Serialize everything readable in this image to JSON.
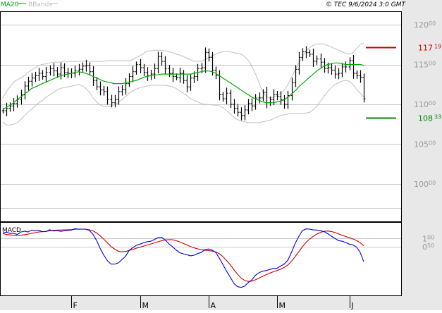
{
  "header": {
    "indicator_ma": "MA20",
    "indicator_bb": "BBands",
    "copyright": "© TEC 9/6/2024 3:0 GMT"
  },
  "colors": {
    "background": "#ffffff",
    "panel_shade": "#e8e8e8",
    "grid": "#c8c8c8",
    "border": "#000000",
    "bars": "#000000",
    "ma": "#00aa00",
    "bands": "#c0c0c0",
    "resistance": "#cc0000",
    "support": "#008800",
    "macd": "#0000dd",
    "signal": "#cc0000",
    "label_text": "#999999",
    "header_text": "#000000"
  },
  "levels": {
    "resistance": {
      "value": 117.19,
      "main": "117",
      "dec": "19"
    },
    "support": {
      "value": 108.33,
      "main": "108",
      "dec": "33"
    }
  },
  "chart_data": [
    {
      "type": "ohlc",
      "panel": "price",
      "xlabel": "",
      "ylabel": "",
      "x_tick_labels": [
        "F",
        "M",
        "A",
        "M",
        "J"
      ],
      "x_tick_positions": [
        19,
        38,
        57,
        76,
        96
      ],
      "y_ticks": [
        {
          "value": 120,
          "main": "120",
          "dec": "00"
        },
        {
          "value": 115,
          "main": "115",
          "dec": "00"
        },
        {
          "value": 110,
          "main": "110",
          "dec": "00"
        },
        {
          "value": 105,
          "main": "105",
          "dec": "00"
        },
        {
          "value": 100,
          "main": "100",
          "dec": "00"
        }
      ],
      "ylim": [
        95.3,
        121.6
      ],
      "grid": true,
      "closes": [
        109.2,
        109.5,
        109.8,
        110.1,
        110.6,
        111.2,
        112.3,
        112.9,
        113.3,
        113.6,
        113.9,
        113.5,
        114.0,
        114.5,
        114.2,
        113.8,
        114.6,
        114.0,
        113.9,
        113.9,
        114.3,
        114.4,
        114.8,
        114.9,
        114.1,
        113.0,
        112.2,
        111.8,
        111.6,
        110.6,
        110.2,
        110.6,
        111.6,
        111.9,
        112.6,
        113.5,
        114.1,
        115.0,
        114.6,
        114.0,
        113.6,
        113.8,
        114.5,
        116.0,
        115.4,
        114.5,
        113.9,
        113.5,
        113.4,
        113.9,
        113.0,
        112.2,
        113.3,
        113.5,
        114.5,
        114.6,
        116.5,
        115.9,
        114.3,
        113.6,
        111.2,
        110.7,
        111.4,
        110.0,
        109.5,
        109.0,
        108.6,
        109.3,
        110.1,
        109.8,
        110.8,
        110.8,
        111.5,
        110.2,
        110.6,
        111.2,
        111.0,
        110.6,
        110.0,
        111.1,
        112.7,
        114.4,
        115.9,
        116.6,
        116.5,
        116.3,
        115.4,
        115.7,
        115.3,
        114.5,
        114.6,
        114.3,
        113.8,
        113.9,
        114.7,
        114.7,
        115.5,
        113.9,
        113.6,
        113.4,
        110.7
      ],
      "ma20": [
        109.4,
        109.6,
        109.9,
        110.2,
        110.6,
        110.9,
        111.3,
        111.6,
        112.0,
        112.2,
        112.4,
        112.6,
        112.8,
        113.0,
        113.2,
        113.4,
        113.6,
        113.7,
        113.8,
        113.9,
        114.0,
        114.1,
        114.0,
        113.9,
        113.7,
        113.5,
        113.3,
        113.1,
        112.9,
        112.8,
        112.7,
        112.6,
        112.6,
        112.6,
        112.7,
        112.8,
        112.9,
        113.0,
        113.2,
        113.4,
        113.5,
        113.6,
        113.7,
        113.7,
        113.8,
        113.8,
        113.8,
        113.8,
        113.8,
        113.8,
        113.8,
        113.8,
        113.8,
        113.9,
        114.0,
        114.1,
        114.2,
        114.2,
        114.1,
        113.9,
        113.6,
        113.3,
        113.0,
        112.7,
        112.4,
        112.1,
        111.8,
        111.5,
        111.2,
        110.9,
        110.7,
        110.5,
        110.3,
        110.2,
        110.2,
        110.2,
        110.3,
        110.4,
        110.6,
        110.9,
        111.3,
        111.7,
        112.2,
        112.6,
        113.0,
        113.4,
        113.8,
        114.2,
        114.5,
        114.8,
        115.0,
        115.1,
        115.2,
        115.2,
        115.1,
        115.0,
        115.0,
        115.0,
        115.0,
        115.0,
        114.9
      ],
      "bb_upper": [
        110.8,
        111.6,
        112.2,
        112.8,
        113.1,
        113.3,
        113.6,
        114.0,
        114.3,
        114.6,
        114.9,
        115.0,
        115.1,
        115.2,
        115.3,
        115.3,
        115.3,
        115.4,
        115.4,
        115.4,
        115.4,
        115.4,
        115.4,
        115.4,
        115.4,
        115.4,
        115.4,
        115.4,
        115.4,
        115.5,
        115.5,
        115.5,
        115.5,
        115.5,
        115.5,
        115.5,
        115.6,
        115.9,
        116.1,
        116.4,
        116.7,
        116.7,
        116.8,
        116.8,
        116.8,
        116.7,
        116.6,
        116.5,
        116.3,
        116.2,
        116.0,
        115.8,
        115.6,
        115.4,
        115.4,
        115.4,
        115.6,
        115.9,
        116.1,
        116.3,
        116.5,
        116.6,
        116.6,
        116.6,
        116.5,
        116.4,
        116.3,
        116.0,
        115.5,
        114.8,
        113.8,
        112.7,
        111.6,
        111.0,
        110.8,
        110.9,
        111.1,
        111.4,
        111.8,
        112.5,
        113.4,
        114.3,
        115.2,
        116.0,
        116.7,
        117.1,
        117.4,
        117.6,
        117.6,
        117.6,
        117.4,
        117.2,
        117.0,
        116.8,
        116.6,
        116.4,
        116.3,
        116.5,
        117.0,
        117.5,
        117.7
      ],
      "bb_lower": [
        107.8,
        107.4,
        107.4,
        107.5,
        107.7,
        108.1,
        108.6,
        109.0,
        109.4,
        109.8,
        110.2,
        110.5,
        110.9,
        111.2,
        111.5,
        111.8,
        112.0,
        112.1,
        112.2,
        112.3,
        112.4,
        112.5,
        112.3,
        112.0,
        111.5,
        110.8,
        110.3,
        109.9,
        109.7,
        109.7,
        109.8,
        110.0,
        110.2,
        110.6,
        111.0,
        111.4,
        111.7,
        111.9,
        112.1,
        112.2,
        112.3,
        112.4,
        112.4,
        112.4,
        112.4,
        112.4,
        112.3,
        112.2,
        112.0,
        111.7,
        111.4,
        111.1,
        110.7,
        110.5,
        110.3,
        110.1,
        110.0,
        110.0,
        109.9,
        109.9,
        109.8,
        109.6,
        109.2,
        108.8,
        108.4,
        108.1,
        107.9,
        107.8,
        107.7,
        107.7,
        107.7,
        107.7,
        107.8,
        107.9,
        108.0,
        108.2,
        108.4,
        108.6,
        108.7,
        108.8,
        108.8,
        108.8,
        108.8,
        108.8,
        108.9,
        109.0,
        109.3,
        109.8,
        110.4,
        111.0,
        111.6,
        112.1,
        112.5,
        112.7,
        112.9,
        113.0,
        112.9,
        112.5,
        111.9,
        111.4,
        110.9
      ]
    },
    {
      "type": "line",
      "panel": "macd",
      "title": "MACD",
      "xlabel": "",
      "ylabel": "",
      "y_ticks": [
        {
          "value": 1.0,
          "main": "1",
          "dec": "00"
        },
        {
          "value": 0.5,
          "main": "0",
          "dec": "50"
        }
      ],
      "ylim": [
        -2.51,
        1.97
      ],
      "grid": true,
      "series": [
        {
          "values": [
            1.35,
            1.39,
            1.31,
            1.32,
            1.25,
            1.4,
            1.45,
            1.4,
            1.52,
            1.48,
            1.5,
            1.42,
            1.43,
            1.54,
            1.46,
            1.49,
            1.44,
            1.47,
            1.49,
            1.52,
            1.6,
            1.57,
            1.58,
            1.58,
            1.49,
            1.25,
            0.87,
            0.38,
            -0.04,
            -0.38,
            -0.58,
            -0.58,
            -0.51,
            -0.3,
            -0.1,
            0.26,
            0.43,
            0.58,
            0.65,
            0.74,
            0.8,
            0.83,
            0.93,
            1.06,
            1.07,
            0.91,
            0.67,
            0.5,
            0.29,
            0.12,
            0.05,
            0.0,
            -0.07,
            -0.03,
            0.07,
            0.14,
            0.31,
            0.35,
            0.28,
            0.14,
            -0.22,
            -0.61,
            -1.02,
            -1.38,
            -1.76,
            -1.97,
            -2.02,
            -1.94,
            -1.72,
            -1.55,
            -1.27,
            -1.11,
            -1.02,
            -0.98,
            -0.91,
            -0.85,
            -0.83,
            -0.7,
            -0.57,
            -0.33,
            0.16,
            0.69,
            1.12,
            1.49,
            1.59,
            1.58,
            1.53,
            1.52,
            1.48,
            1.42,
            1.3,
            1.15,
            1.01,
            0.87,
            0.83,
            0.75,
            0.65,
            0.6,
            0.47,
            0.14,
            -0.43
          ]
        },
        {
          "values": [
            1.3,
            1.25,
            1.22,
            1.2,
            1.18,
            1.2,
            1.24,
            1.27,
            1.32,
            1.36,
            1.4,
            1.42,
            1.44,
            1.48,
            1.5,
            1.52,
            1.52,
            1.53,
            1.54,
            1.55,
            1.57,
            1.58,
            1.58,
            1.57,
            1.54,
            1.47,
            1.34,
            1.16,
            0.95,
            0.72,
            0.5,
            0.34,
            0.22,
            0.18,
            0.2,
            0.26,
            0.32,
            0.4,
            0.46,
            0.53,
            0.6,
            0.66,
            0.73,
            0.8,
            0.86,
            0.91,
            0.93,
            0.92,
            0.87,
            0.79,
            0.7,
            0.6,
            0.5,
            0.42,
            0.36,
            0.31,
            0.28,
            0.25,
            0.22,
            0.17,
            0.06,
            -0.12,
            -0.36,
            -0.62,
            -0.92,
            -1.2,
            -1.43,
            -1.59,
            -1.65,
            -1.63,
            -1.55,
            -1.44,
            -1.33,
            -1.23,
            -1.13,
            -1.05,
            -0.98,
            -0.89,
            -0.78,
            -0.63,
            -0.4,
            -0.12,
            0.18,
            0.49,
            0.75,
            0.97,
            1.13,
            1.27,
            1.38,
            1.44,
            1.46,
            1.43,
            1.37,
            1.28,
            1.2,
            1.12,
            1.05,
            0.97,
            0.88,
            0.74,
            0.55
          ]
        }
      ]
    }
  ]
}
